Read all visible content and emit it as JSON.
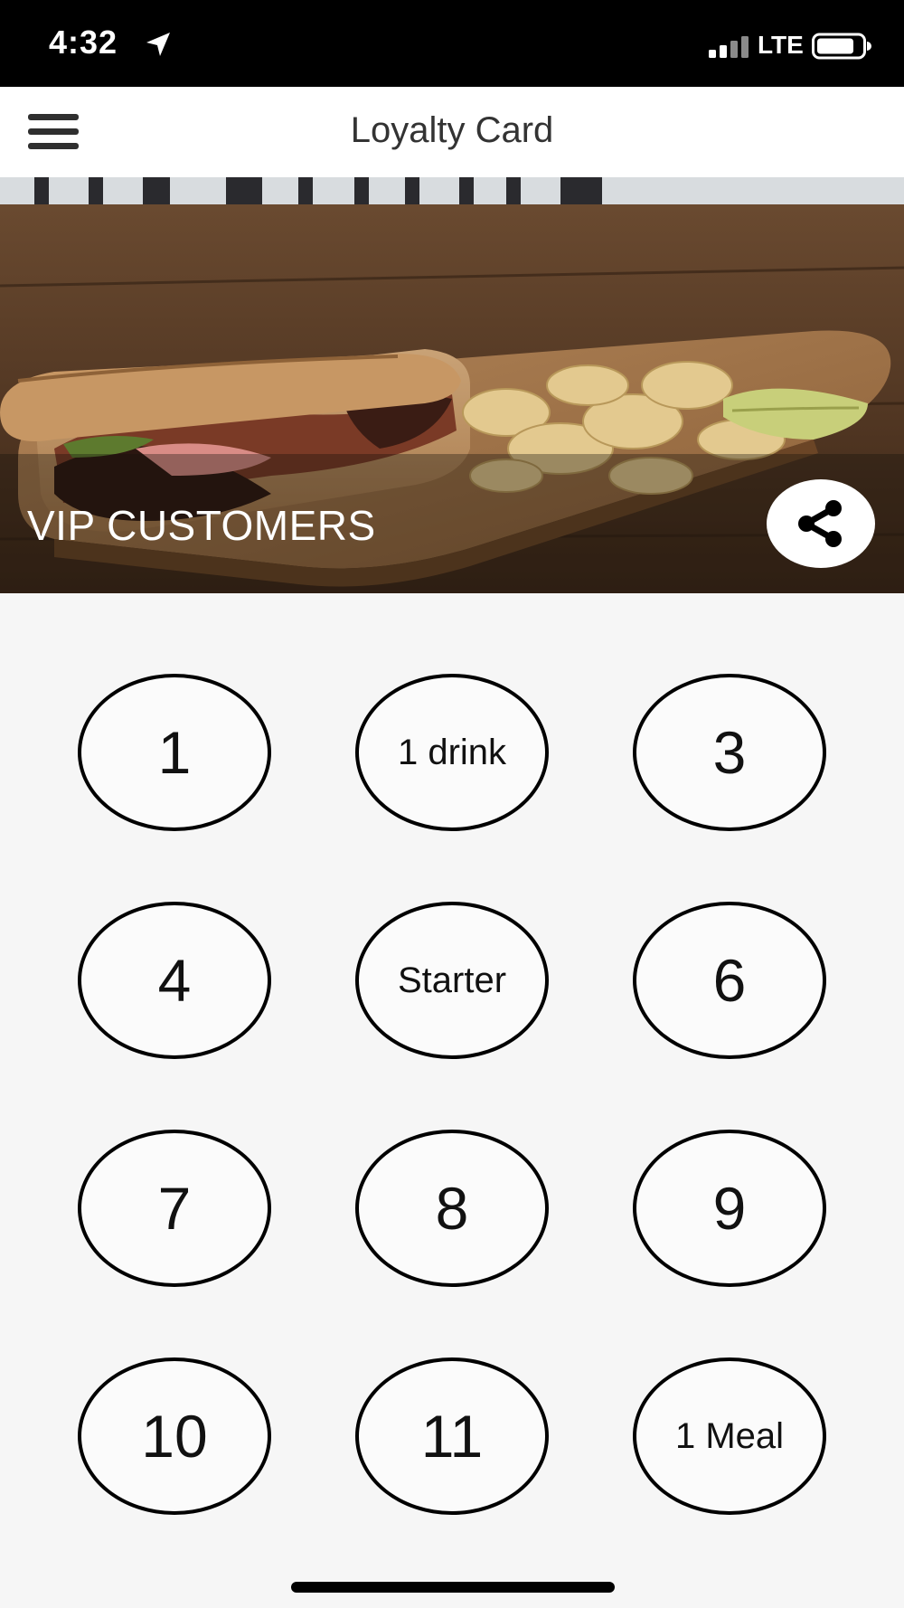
{
  "status_bar": {
    "time": "4:32",
    "network": "LTE",
    "icons": [
      "location-arrow-icon",
      "signal-icon",
      "battery-icon"
    ]
  },
  "header": {
    "title": "Loyalty Card",
    "menu_icon": "hamburger-menu-icon"
  },
  "hero": {
    "card_name": "VIP CUSTOMERS",
    "share_icon": "share-icon",
    "image": "sandwich-and-chips-photo"
  },
  "stamps": [
    {
      "label": "1",
      "kind": "number"
    },
    {
      "label": "1 drink",
      "kind": "reward"
    },
    {
      "label": "3",
      "kind": "number"
    },
    {
      "label": "4",
      "kind": "number"
    },
    {
      "label": "Starter",
      "kind": "reward"
    },
    {
      "label": "6",
      "kind": "number"
    },
    {
      "label": "7",
      "kind": "number"
    },
    {
      "label": "8",
      "kind": "number"
    },
    {
      "label": "9",
      "kind": "number"
    },
    {
      "label": "10",
      "kind": "number"
    },
    {
      "label": "11",
      "kind": "number"
    },
    {
      "label": "1 Meal",
      "kind": "reward"
    }
  ],
  "colors": {
    "status_bar_bg": "#000000",
    "header_bg": "#ffffff",
    "page_bg": "#f6f6f6",
    "stamp_border": "#000000",
    "title_text": "#333333"
  }
}
